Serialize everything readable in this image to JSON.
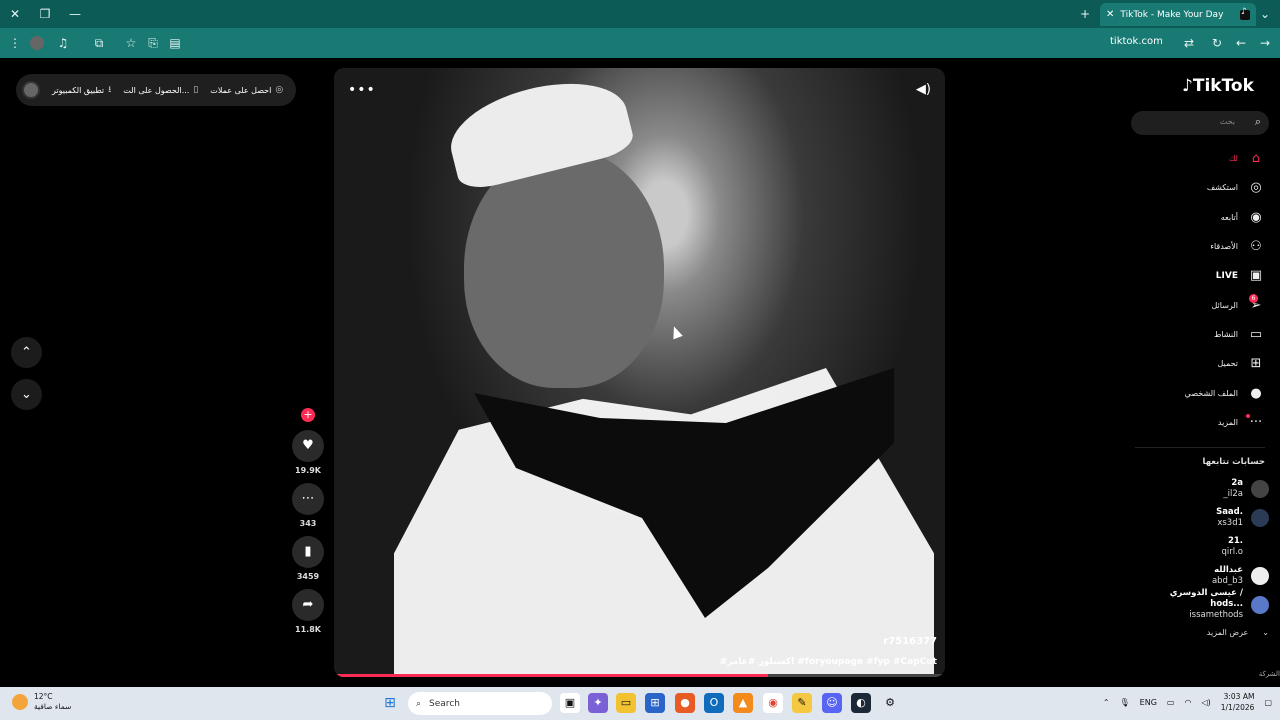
{
  "browser": {
    "tab_title": "TikTok - Make Your Day",
    "url": "tiktok.com",
    "controls": {
      "close": "✕",
      "restore": "❐",
      "minimize": "—",
      "new_tab": "+",
      "tab_close": "✕"
    },
    "toolbar_icons": [
      "menu-icon",
      "profile-icon",
      "media-icon",
      "extensions-icon",
      "star-icon",
      "screenshot-icon",
      "split-icon",
      "reload-icon",
      "back-icon",
      "forward-icon"
    ]
  },
  "topbar": {
    "get_coins": "احصل على عملات",
    "get_app": "الحصول على الت...",
    "pc_app": "تطبيق الكمبيوتر"
  },
  "video": {
    "author_handle": "r7516377",
    "caption": "#اكسبلور #عامر #foryoupage #fyp #CapCut",
    "progress": 0.71
  },
  "actions": {
    "likes": "19.9K",
    "comments": "343",
    "saves": "3459",
    "shares": "11.8K"
  },
  "sidebar": {
    "logo": "TikTok",
    "search_placeholder": "بحث",
    "menu": [
      {
        "label": "لك",
        "icon": "home-icon"
      },
      {
        "label": "استكشف",
        "icon": "compass-icon"
      },
      {
        "label": "أتابعه",
        "icon": "following-icon"
      },
      {
        "label": "الأصدقاء",
        "icon": "friends-icon"
      },
      {
        "label": "LIVE",
        "icon": "live-icon"
      },
      {
        "label": "الرسائل",
        "icon": "messages-icon",
        "badge": "6"
      },
      {
        "label": "النشاط",
        "icon": "activity-icon"
      },
      {
        "label": "تحميل",
        "icon": "upload-icon"
      },
      {
        "label": "الملف الشخصي",
        "icon": "profile-icon"
      },
      {
        "label": "المزيد",
        "icon": "more-icon"
      }
    ],
    "following_title": "حسابات تتابعها",
    "accounts": [
      {
        "name": "2a",
        "handle": "_il2a"
      },
      {
        "name": "Saad.",
        "handle": "xs3d1"
      },
      {
        "name": "21.",
        "handle": "qirl.o"
      },
      {
        "name": "عبدالله",
        "handle": "abd_b3"
      },
      {
        "name": "عيسى الدوسري / hods...",
        "handle": "issamethods"
      }
    ],
    "show_more": "عرض المزيد",
    "company": "الشركة"
  },
  "taskbar": {
    "weather_temp": "12°C",
    "weather_desc": "سماء صافية",
    "search": "Search",
    "lang": "ENG",
    "time": "3:03 AM",
    "date": "1/1/2026"
  }
}
